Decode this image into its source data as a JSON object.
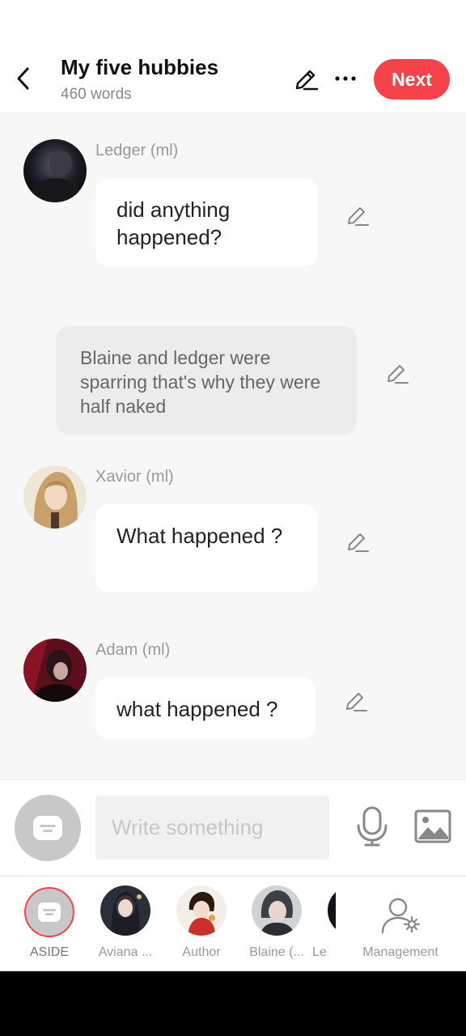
{
  "header": {
    "title": "My five hubbies",
    "word_count": "460 words",
    "next_label": "Next"
  },
  "messages": [
    {
      "type": "character",
      "speaker": "Ledger (ml)",
      "text": "did anything happened?"
    },
    {
      "type": "narration",
      "text": "Blaine and ledger were sparring that's why they were half naked"
    },
    {
      "type": "character",
      "speaker": "Xavior (ml)",
      "text": "What happened ?"
    },
    {
      "type": "character",
      "speaker": "Adam (ml)",
      "text": "what happened ?"
    }
  ],
  "composer": {
    "placeholder": "Write something"
  },
  "characters": [
    {
      "label": "ASIDE"
    },
    {
      "label": "Aviana ..."
    },
    {
      "label": "Author"
    },
    {
      "label": "Blaine (..."
    },
    {
      "label": "Le"
    },
    {
      "label": "Management"
    }
  ],
  "colors": {
    "accent": "#f74249",
    "background": "#f7f7f7",
    "bubble": "#ffffff",
    "narration_bubble": "#ececec"
  }
}
